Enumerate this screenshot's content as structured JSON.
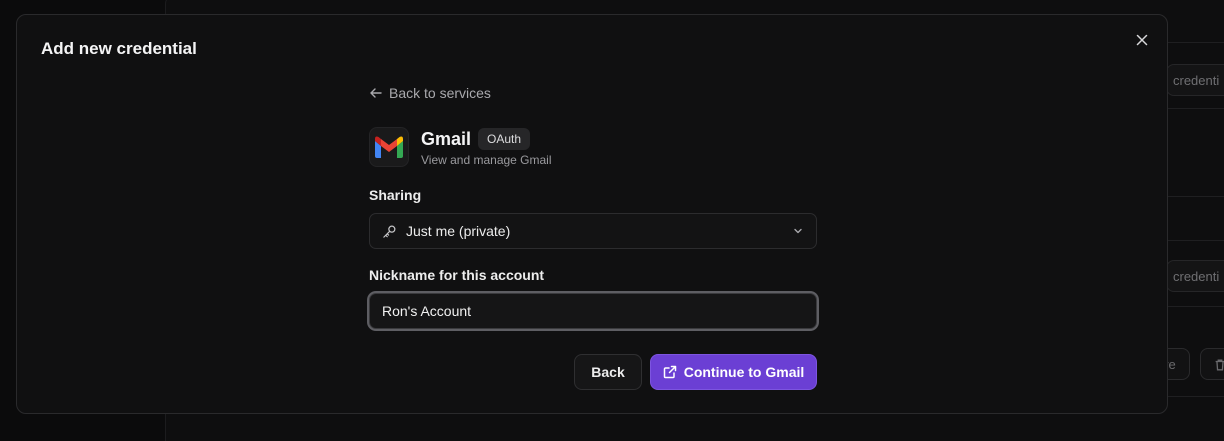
{
  "background": {
    "cards": [
      {
        "label": "credenti"
      },
      {
        "label": "credenti"
      }
    ],
    "share_btn_fragment": "re"
  },
  "modal": {
    "title": "Add new credential",
    "back_link": "Back to services",
    "service": {
      "name": "Gmail",
      "badge": "OAuth",
      "description": "View and manage Gmail",
      "icon": "gmail-logo"
    },
    "sharing": {
      "label": "Sharing",
      "value": "Just me (private)",
      "icon": "key-icon"
    },
    "nickname": {
      "label": "Nickname for this account",
      "value": "Ron's Account"
    },
    "buttons": {
      "back": "Back",
      "continue": "Continue to Gmail"
    }
  },
  "colors": {
    "accent": "#6b3fd4",
    "modal_bg": "#101011",
    "page_bg": "#0b0b0c"
  }
}
